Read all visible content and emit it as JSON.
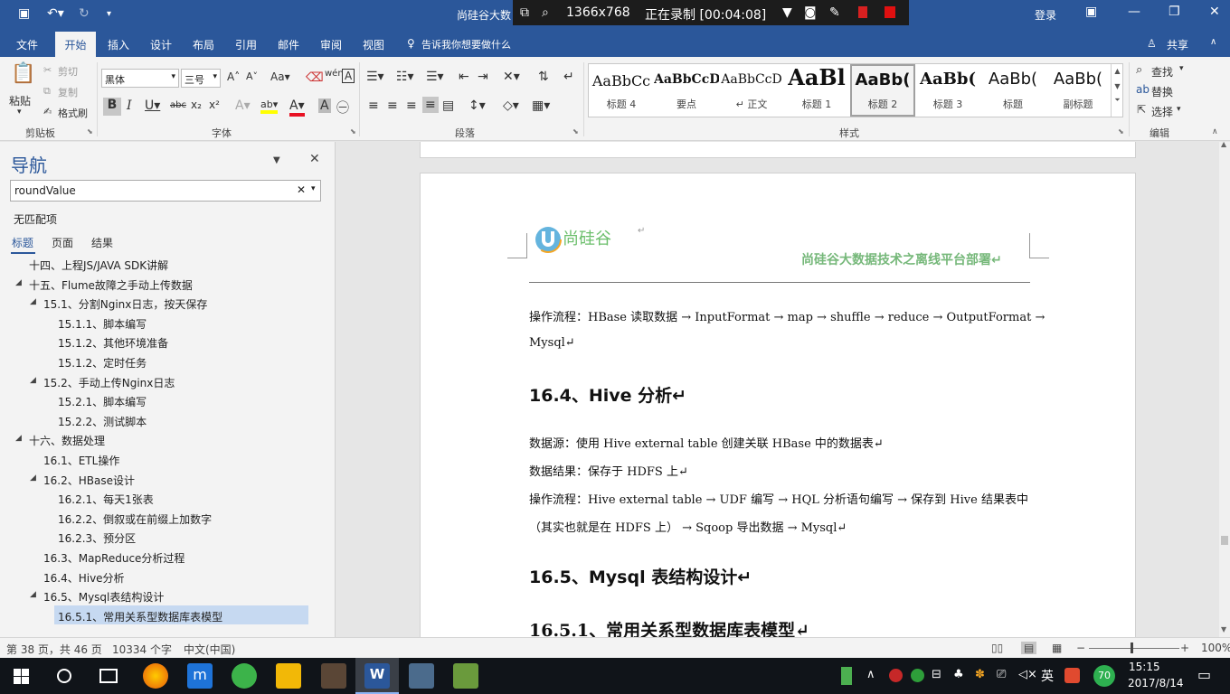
{
  "title_bar": {
    "doc_title": "尚硅谷大数",
    "login": "登录"
  },
  "recording": {
    "resolution": "1366x768",
    "status": "正在录制 [00:04:08]"
  },
  "ribbon_tabs": [
    "文件",
    "开始",
    "插入",
    "设计",
    "布局",
    "引用",
    "邮件",
    "审阅",
    "视图"
  ],
  "tell_me": "告诉我你想要做什么",
  "share": "共享",
  "clipboard": {
    "paste": "粘贴",
    "cut": "剪切",
    "copy": "复制",
    "format_painter": "格式刷",
    "group": "剪贴板"
  },
  "font": {
    "name": "黑体",
    "size": "三号",
    "group": "字体"
  },
  "paragraph": {
    "group": "段落"
  },
  "styles": {
    "group": "样式",
    "items": [
      {
        "preview": "AaBbCc",
        "name": "标题 4"
      },
      {
        "preview": "AaBbCcD",
        "name": "要点"
      },
      {
        "preview": "AaBbCcD",
        "name": "↵ 正文"
      },
      {
        "preview": "AaBl",
        "name": "标题 1"
      },
      {
        "preview": "AaBb(",
        "name": "标题 2"
      },
      {
        "preview": "AaBb(",
        "name": "标题 3"
      },
      {
        "preview": "AaBb(",
        "name": "标题"
      },
      {
        "preview": "AaBb(",
        "name": "副标题"
      }
    ]
  },
  "editing": {
    "find": "查找",
    "replace": "替换",
    "select": "选择",
    "group": "编辑"
  },
  "nav": {
    "title": "导航",
    "search_value": "roundValue",
    "no_match": "无匹配项",
    "tabs": [
      "标题",
      "页面",
      "结果"
    ],
    "items": [
      {
        "text": "十四、上程JS/JAVA SDK讲解",
        "level": 1,
        "toggle": ""
      },
      {
        "text": "十五、Flume故障之手动上传数据",
        "level": 1,
        "toggle": "◢"
      },
      {
        "text": "15.1、分割Nginx日志，按天保存",
        "level": 2,
        "toggle": "◢"
      },
      {
        "text": "15.1.1、脚本编写",
        "level": 3,
        "toggle": ""
      },
      {
        "text": "15.1.2、其他环境准备",
        "level": 3,
        "toggle": ""
      },
      {
        "text": "15.1.2、定时任务",
        "level": 3,
        "toggle": ""
      },
      {
        "text": "15.2、手动上传Nginx日志",
        "level": 2,
        "toggle": "◢"
      },
      {
        "text": "15.2.1、脚本编写",
        "level": 3,
        "toggle": ""
      },
      {
        "text": "15.2.2、测试脚本",
        "level": 3,
        "toggle": ""
      },
      {
        "text": "十六、数据处理",
        "level": 1,
        "toggle": "◢"
      },
      {
        "text": "16.1、ETL操作",
        "level": 2,
        "toggle": ""
      },
      {
        "text": "16.2、HBase设计",
        "level": 2,
        "toggle": "◢"
      },
      {
        "text": "16.2.1、每天1张表",
        "level": 3,
        "toggle": ""
      },
      {
        "text": "16.2.2、倒叙或在前缀上加数字",
        "level": 3,
        "toggle": ""
      },
      {
        "text": "16.2.3、预分区",
        "level": 3,
        "toggle": ""
      },
      {
        "text": "16.3、MapReduce分析过程",
        "level": 2,
        "toggle": ""
      },
      {
        "text": "16.4、Hive分析",
        "level": 2,
        "toggle": ""
      },
      {
        "text": "16.5、Mysql表结构设计",
        "level": 2,
        "toggle": "◢"
      },
      {
        "text": "16.5.1、常用关系型数据库表模型",
        "level": 3,
        "toggle": ""
      }
    ]
  },
  "document": {
    "logo_text": "尚硅谷",
    "header": "尚硅谷大数据技术之离线平台部署↵",
    "p1": "操作流程：HBase 读取数据 → InputFormat → map → shuffle → reduce → OutputFormat →",
    "p1b": "Mysql↵",
    "h_hive": "16.4、Hive 分析↵",
    "p2": "数据源：使用 Hive external table  创建关联 HBase 中的数据表↵",
    "p3": "数据结果：保存于 HDFS 上↵",
    "p4": "操作流程：Hive external table → UDF 编写  → HQL 分析语句编写  →  保存到 Hive 结果表中",
    "p5": "（其实也就是在 HDFS 上）  → Sqoop 导出数据  → Mysql↵",
    "h_mysql": "16.5、Mysql 表结构设计↵",
    "h_model": "16.5.1、常用关系型数据库表模型↵"
  },
  "status": {
    "page": "第 38 页，共 46 页",
    "words": "10334 个字",
    "lang": "中文(中国)",
    "zoom": "100%"
  },
  "taskbar": {
    "ime": "英",
    "badge": "70",
    "time": "15:15",
    "date": "2017/8/14"
  }
}
